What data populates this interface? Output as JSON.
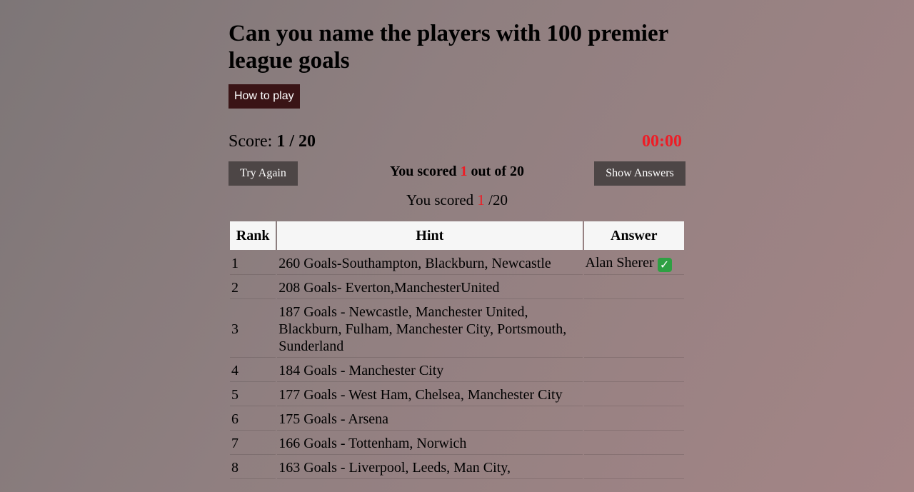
{
  "quiz": {
    "title": "Can you name the players with 100 premier league goals",
    "how_to_play_label": "How to play",
    "score_prefix": "Score:",
    "score_value": "1 / 20",
    "timer": "00:00",
    "try_again_label": "Try Again",
    "show_answers_label": "Show Answers",
    "result_bold": {
      "prefix": "You scored",
      "score": "1",
      "suffix": "out of 20"
    },
    "result_plain": {
      "prefix": "You scored",
      "score": "1",
      "suffix": "/20"
    },
    "colors": {
      "accent_red": "#ee1c25",
      "how_to_play_bg": "#3a1416",
      "button_bg": "#4d4646",
      "check_green": "#2ea043"
    }
  },
  "table": {
    "headers": {
      "rank": "Rank",
      "hint": "Hint",
      "answer": "Answer"
    },
    "rows": [
      {
        "rank": "1",
        "hint": "260 Goals-Southampton, Blackburn, Newcastle",
        "answer": "Alan Sherer",
        "icon": "check-mark-icon"
      },
      {
        "rank": "2",
        "hint": "208 Goals- Everton,ManchesterUnited",
        "answer": ""
      },
      {
        "rank": "3",
        "hint": "187 Goals - Newcastle, Manchester United, Blackburn, Fulham, Manchester City, Portsmouth, Sunderland",
        "answer": ""
      },
      {
        "rank": "4",
        "hint": "184 Goals - Manchester City",
        "answer": ""
      },
      {
        "rank": "5",
        "hint": "177 Goals - West Ham, Chelsea, Manchester City",
        "answer": ""
      },
      {
        "rank": "6",
        "hint": "175 Goals - Arsena",
        "answer": ""
      },
      {
        "rank": "7",
        "hint": "166 Goals - Tottenham, Norwich",
        "answer": ""
      },
      {
        "rank": "8",
        "hint": "163 Goals - Liverpool, Leeds, Man City,",
        "answer": ""
      }
    ]
  }
}
